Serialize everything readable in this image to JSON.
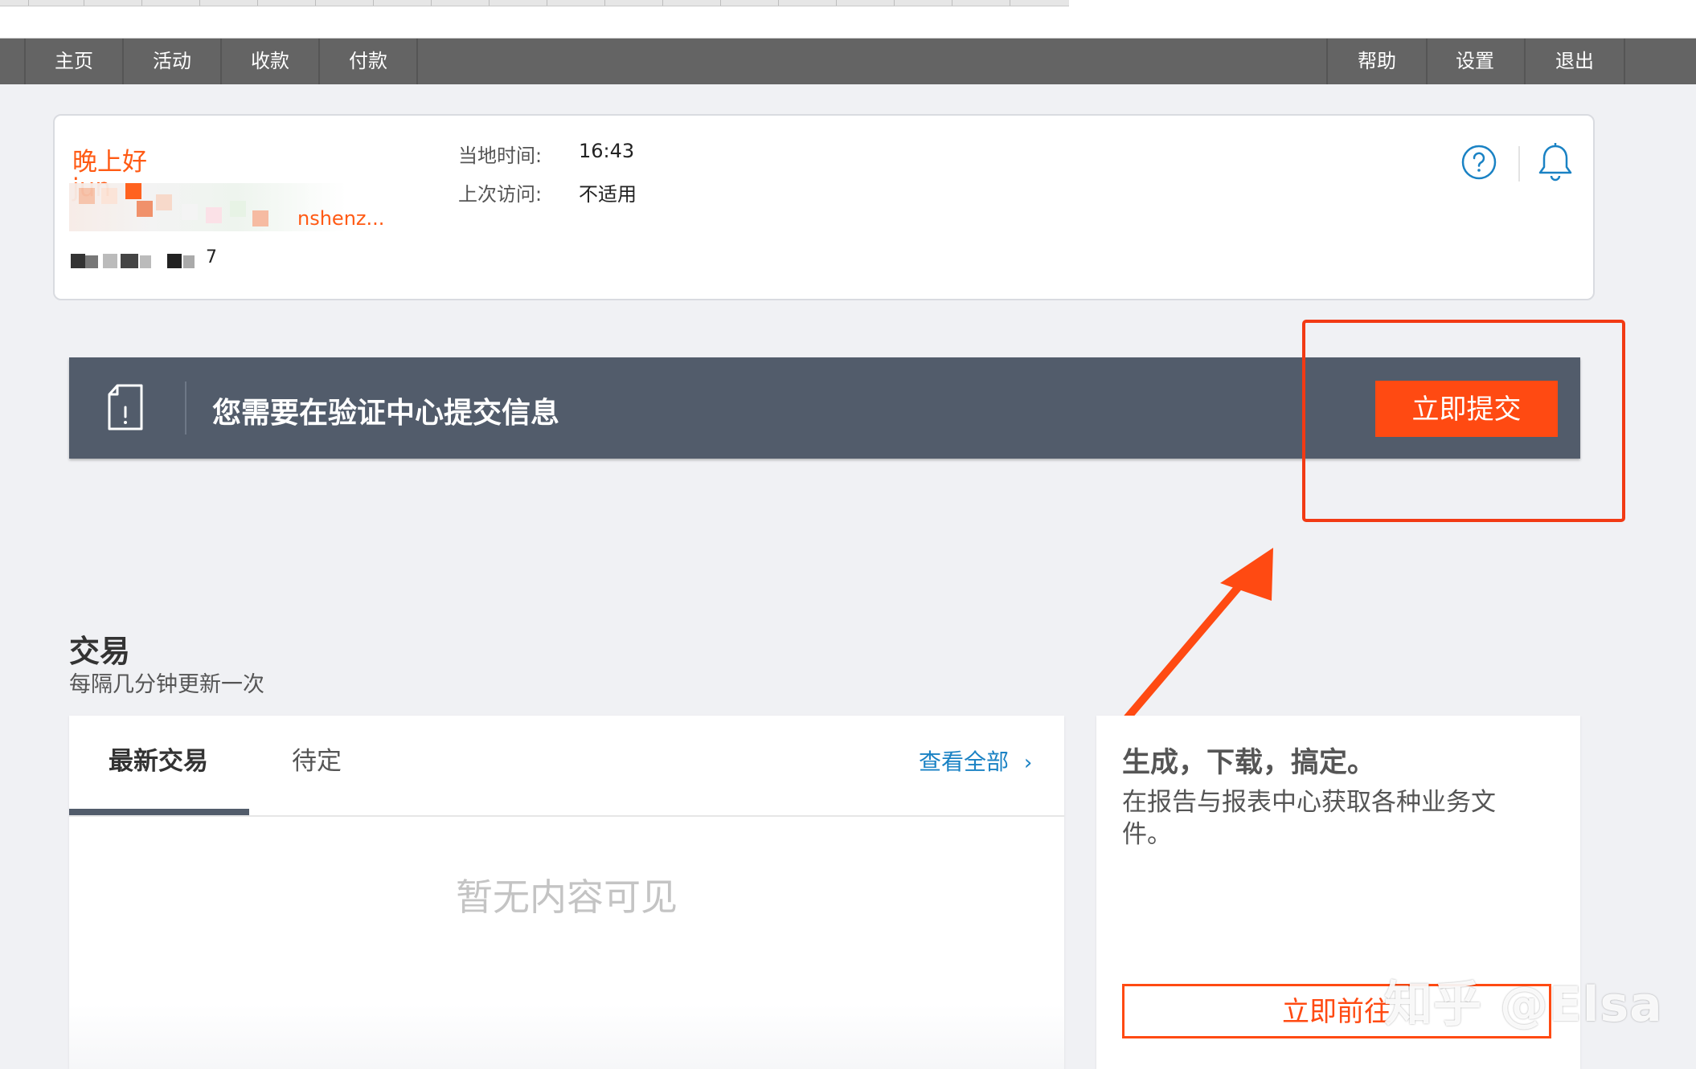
{
  "nav": {
    "left": [
      "主页",
      "活动",
      "收款",
      "付款"
    ],
    "right": [
      "帮助",
      "设置",
      "退出"
    ]
  },
  "greeting_card": {
    "greeting": "晚上好",
    "username_partial": "jun",
    "company_partial": "nshenz...",
    "account_fragment": "7",
    "local_time_label": "当地时间:",
    "local_time_value": "16:43",
    "last_visit_label": "上次访问:",
    "last_visit_value": "不适用"
  },
  "banner": {
    "message": "您需要在验证中心提交信息",
    "button_label": "立即提交"
  },
  "transactions": {
    "title": "交易",
    "subtitle": "每隔几分钟更新一次",
    "tabs": [
      "最新交易",
      "待定"
    ],
    "view_all": "查看全部",
    "empty": "暂无内容可见"
  },
  "promo": {
    "title": "生成，下载，搞定。",
    "description": "在报告与报表中心获取各种业务文件。",
    "button_label": "立即前往"
  },
  "watermark": "知乎 @Elsa",
  "colors": {
    "accent": "#ff4a12",
    "nav_bg": "#646464",
    "banner_bg": "#525c6b",
    "link": "#1a82c4",
    "annotation": "#f23a14"
  }
}
